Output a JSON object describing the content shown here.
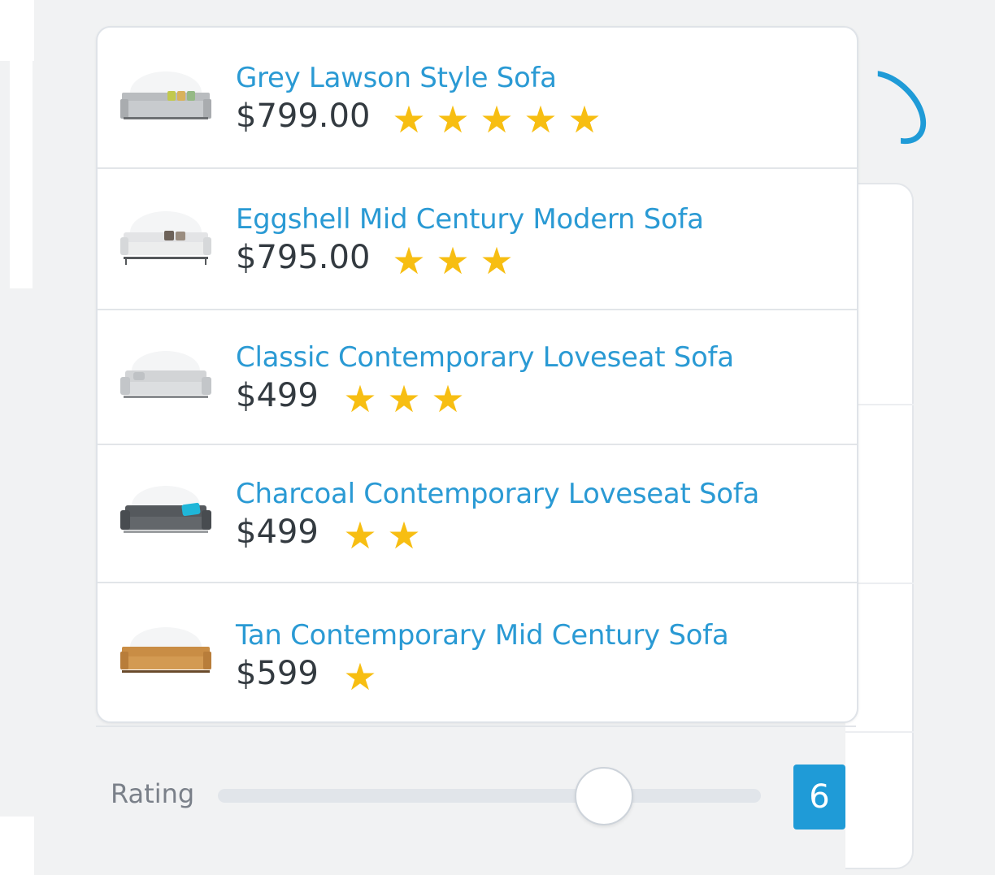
{
  "results": [
    {
      "title": "Grey Lawson Style Sofa",
      "price": "$799.00",
      "rating": 5,
      "image": "grey-sofa"
    },
    {
      "title": "Eggshell Mid Century Modern Sofa",
      "price": "$795.00",
      "rating": 3,
      "image": "eggshell-sofa"
    },
    {
      "title": "Classic Contemporary Loveseat Sofa",
      "price": "$499",
      "rating": 3,
      "image": "classic-loveseat"
    },
    {
      "title": "Charcoal Contemporary Loveseat Sofa",
      "price": "$499",
      "rating": 2,
      "image": "charcoal-loveseat"
    },
    {
      "title": "Tan Contemporary Mid Century Sofa",
      "price": "$599",
      "rating": 1,
      "image": "tan-sofa"
    }
  ],
  "filter": {
    "label": "Rating",
    "value": "6",
    "slider_level": 0.6
  },
  "icons": {
    "star": "star-icon"
  },
  "colors": {
    "link": "#2a9ad4",
    "star": "#f7be12",
    "accent": "#1f9bd7",
    "price": "#333a40"
  }
}
